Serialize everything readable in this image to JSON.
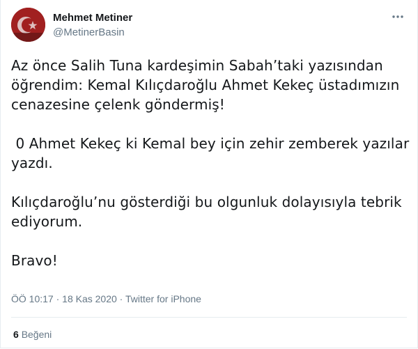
{
  "tweet": {
    "author": {
      "name": "Mehmet Metiner",
      "handle": "@MetinerBasin",
      "avatar_icon": "avatar-flag-icon"
    },
    "more_icon": "more-horizontal-icon",
    "paragraphs": [
      "Az önce Salih Tuna kardeşimin Sabah’taki yazısından öğrendim: Kemal Kılıçdaroğlu Ahmet Kekeç üstadımızın cenazesine çelenk göndermiş!",
      " 0 Ahmet Kekeç ki Kemal bey için zehir zemberek yazılar yazdı.",
      "Kılıçdaroğlu’nu gösterdiği bu olgunluk dolayısıyla tebrik ediyorum.",
      "Bravo!"
    ],
    "time": "ÖÖ 10:17",
    "separator": " · ",
    "date": "18 Kas 2020",
    "source": "Twitter for iPhone",
    "likes_count": "6",
    "likes_label": "Beğeni"
  },
  "colors": {
    "text_primary": "#14171a",
    "text_secondary": "#657786",
    "border": "#e6ecf0"
  }
}
